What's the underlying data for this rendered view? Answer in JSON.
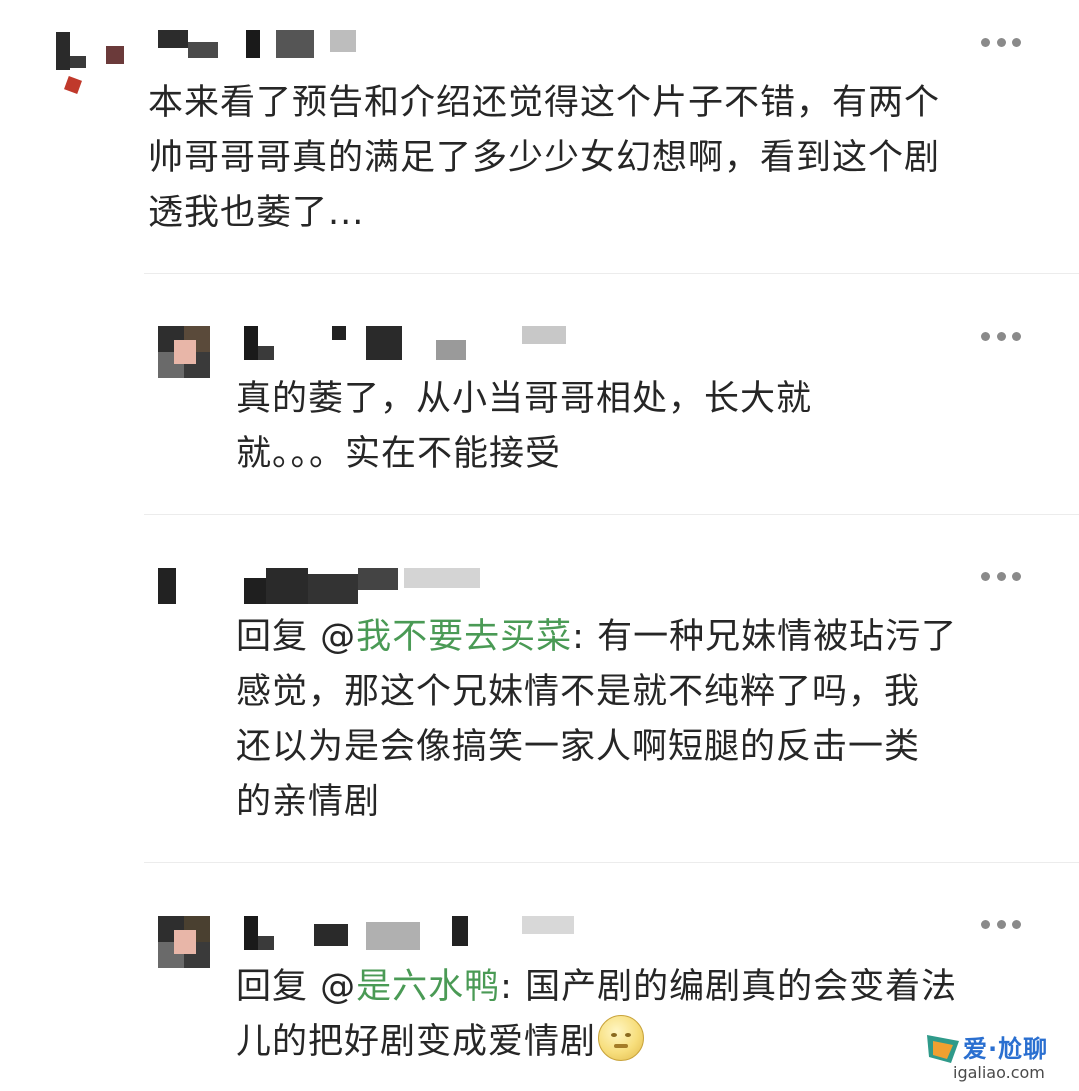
{
  "comments": [
    {
      "text": "本来看了预告和介绍还觉得这个片子不错，有两个\n帅哥哥哥真的满足了多少少女幻想啊，看到这个剧\n透我也萎了..."
    },
    {
      "text": "真的萎了，从小当哥哥相处，长大就\n就。。。实在不能接受"
    },
    {
      "prefix": "回复 @",
      "mention": "我不要去买菜",
      "body": ": 有一种兄妹情被玷污了\n感觉，那这个兄妹情不是就不纯粹了吗，我\n还以为是会像搞笑一家人啊短腿的反击一类\n的亲情剧"
    },
    {
      "prefix": "回复 @",
      "mention": "是六水鸭",
      "body": ": 国产剧的编剧真的会变着法\n儿的把好剧变成爱情剧"
    }
  ],
  "watermark": {
    "title": "爱·尬聊",
    "site": "igaliao.com"
  },
  "colors": {
    "mention": "#4a9a55",
    "text": "#262626",
    "more_dots": "#8a8a8a"
  },
  "icons": [
    "more-dots-icon",
    "smile-emoji-icon"
  ]
}
